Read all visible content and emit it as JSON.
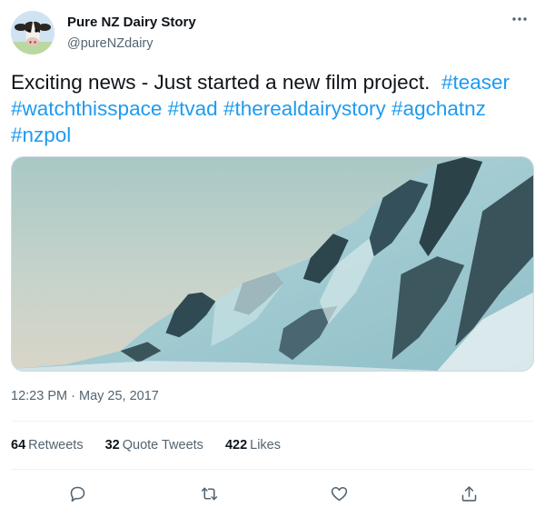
{
  "author": {
    "name": "Pure NZ Dairy Story",
    "handle": "@pureNZdairy",
    "avatar_icon": "cow-avatar-icon"
  },
  "tweet": {
    "text_lead": "Exciting news - Just started a new film project.",
    "hashtags": [
      "#teaser",
      "#watchthisspace",
      "#tvad",
      "#therealdairystory",
      "#agchatnz",
      "#nzpol"
    ],
    "media_description_icon": "mountain-video-thumbnail"
  },
  "meta": {
    "time": "12:23 PM",
    "separator": "·",
    "date": "May 25, 2017"
  },
  "stats": {
    "retweets_count": "64",
    "retweets_label": "Retweets",
    "quotes_count": "32",
    "quotes_label": "Quote Tweets",
    "likes_count": "422",
    "likes_label": "Likes"
  },
  "actions": {
    "reply_icon": "reply-icon",
    "retweet_icon": "retweet-icon",
    "like_icon": "heart-icon",
    "share_icon": "share-icon"
  },
  "colors": {
    "link": "#1d9bf0",
    "secondary_text": "#536471",
    "primary_text": "#0f1419",
    "divider": "#eff3f4"
  }
}
